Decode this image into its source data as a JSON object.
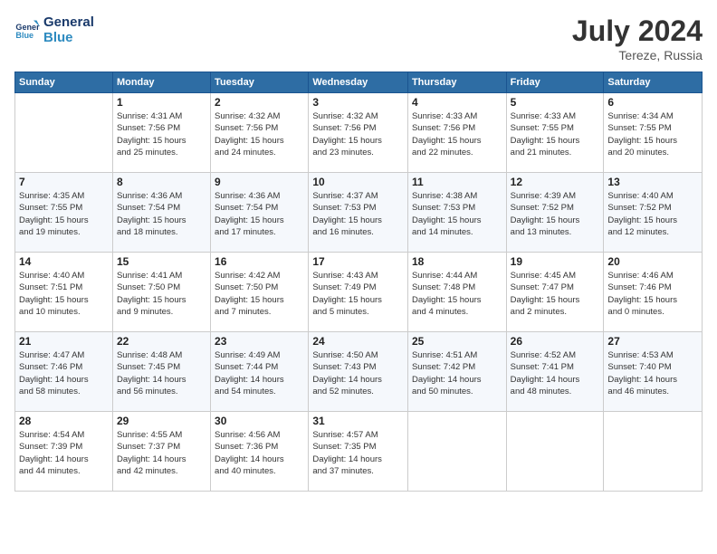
{
  "header": {
    "logo_line1": "General",
    "logo_line2": "Blue",
    "month_year": "July 2024",
    "location": "Tereze, Russia"
  },
  "days_of_week": [
    "Sunday",
    "Monday",
    "Tuesday",
    "Wednesday",
    "Thursday",
    "Friday",
    "Saturday"
  ],
  "weeks": [
    [
      {
        "day": "",
        "info": ""
      },
      {
        "day": "1",
        "info": "Sunrise: 4:31 AM\nSunset: 7:56 PM\nDaylight: 15 hours\nand 25 minutes."
      },
      {
        "day": "2",
        "info": "Sunrise: 4:32 AM\nSunset: 7:56 PM\nDaylight: 15 hours\nand 24 minutes."
      },
      {
        "day": "3",
        "info": "Sunrise: 4:32 AM\nSunset: 7:56 PM\nDaylight: 15 hours\nand 23 minutes."
      },
      {
        "day": "4",
        "info": "Sunrise: 4:33 AM\nSunset: 7:56 PM\nDaylight: 15 hours\nand 22 minutes."
      },
      {
        "day": "5",
        "info": "Sunrise: 4:33 AM\nSunset: 7:55 PM\nDaylight: 15 hours\nand 21 minutes."
      },
      {
        "day": "6",
        "info": "Sunrise: 4:34 AM\nSunset: 7:55 PM\nDaylight: 15 hours\nand 20 minutes."
      }
    ],
    [
      {
        "day": "7",
        "info": "Sunrise: 4:35 AM\nSunset: 7:55 PM\nDaylight: 15 hours\nand 19 minutes."
      },
      {
        "day": "8",
        "info": "Sunrise: 4:36 AM\nSunset: 7:54 PM\nDaylight: 15 hours\nand 18 minutes."
      },
      {
        "day": "9",
        "info": "Sunrise: 4:36 AM\nSunset: 7:54 PM\nDaylight: 15 hours\nand 17 minutes."
      },
      {
        "day": "10",
        "info": "Sunrise: 4:37 AM\nSunset: 7:53 PM\nDaylight: 15 hours\nand 16 minutes."
      },
      {
        "day": "11",
        "info": "Sunrise: 4:38 AM\nSunset: 7:53 PM\nDaylight: 15 hours\nand 14 minutes."
      },
      {
        "day": "12",
        "info": "Sunrise: 4:39 AM\nSunset: 7:52 PM\nDaylight: 15 hours\nand 13 minutes."
      },
      {
        "day": "13",
        "info": "Sunrise: 4:40 AM\nSunset: 7:52 PM\nDaylight: 15 hours\nand 12 minutes."
      }
    ],
    [
      {
        "day": "14",
        "info": "Sunrise: 4:40 AM\nSunset: 7:51 PM\nDaylight: 15 hours\nand 10 minutes."
      },
      {
        "day": "15",
        "info": "Sunrise: 4:41 AM\nSunset: 7:50 PM\nDaylight: 15 hours\nand 9 minutes."
      },
      {
        "day": "16",
        "info": "Sunrise: 4:42 AM\nSunset: 7:50 PM\nDaylight: 15 hours\nand 7 minutes."
      },
      {
        "day": "17",
        "info": "Sunrise: 4:43 AM\nSunset: 7:49 PM\nDaylight: 15 hours\nand 5 minutes."
      },
      {
        "day": "18",
        "info": "Sunrise: 4:44 AM\nSunset: 7:48 PM\nDaylight: 15 hours\nand 4 minutes."
      },
      {
        "day": "19",
        "info": "Sunrise: 4:45 AM\nSunset: 7:47 PM\nDaylight: 15 hours\nand 2 minutes."
      },
      {
        "day": "20",
        "info": "Sunrise: 4:46 AM\nSunset: 7:46 PM\nDaylight: 15 hours\nand 0 minutes."
      }
    ],
    [
      {
        "day": "21",
        "info": "Sunrise: 4:47 AM\nSunset: 7:46 PM\nDaylight: 14 hours\nand 58 minutes."
      },
      {
        "day": "22",
        "info": "Sunrise: 4:48 AM\nSunset: 7:45 PM\nDaylight: 14 hours\nand 56 minutes."
      },
      {
        "day": "23",
        "info": "Sunrise: 4:49 AM\nSunset: 7:44 PM\nDaylight: 14 hours\nand 54 minutes."
      },
      {
        "day": "24",
        "info": "Sunrise: 4:50 AM\nSunset: 7:43 PM\nDaylight: 14 hours\nand 52 minutes."
      },
      {
        "day": "25",
        "info": "Sunrise: 4:51 AM\nSunset: 7:42 PM\nDaylight: 14 hours\nand 50 minutes."
      },
      {
        "day": "26",
        "info": "Sunrise: 4:52 AM\nSunset: 7:41 PM\nDaylight: 14 hours\nand 48 minutes."
      },
      {
        "day": "27",
        "info": "Sunrise: 4:53 AM\nSunset: 7:40 PM\nDaylight: 14 hours\nand 46 minutes."
      }
    ],
    [
      {
        "day": "28",
        "info": "Sunrise: 4:54 AM\nSunset: 7:39 PM\nDaylight: 14 hours\nand 44 minutes."
      },
      {
        "day": "29",
        "info": "Sunrise: 4:55 AM\nSunset: 7:37 PM\nDaylight: 14 hours\nand 42 minutes."
      },
      {
        "day": "30",
        "info": "Sunrise: 4:56 AM\nSunset: 7:36 PM\nDaylight: 14 hours\nand 40 minutes."
      },
      {
        "day": "31",
        "info": "Sunrise: 4:57 AM\nSunset: 7:35 PM\nDaylight: 14 hours\nand 37 minutes."
      },
      {
        "day": "",
        "info": ""
      },
      {
        "day": "",
        "info": ""
      },
      {
        "day": "",
        "info": ""
      }
    ]
  ]
}
